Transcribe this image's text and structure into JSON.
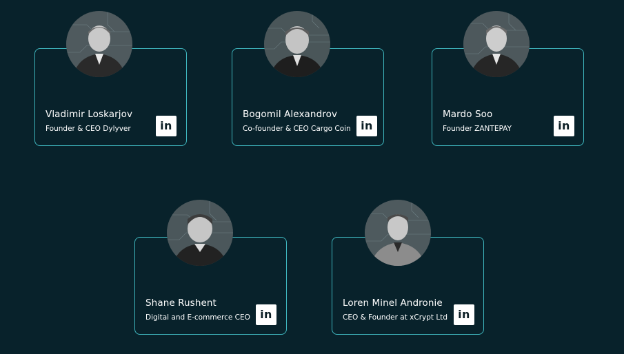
{
  "team": [
    {
      "name": "Vladimir Loskarjov",
      "role": "Founder & CEO Dylyver",
      "linkedin_icon": "linkedin-icon",
      "linkedin_text": "in"
    },
    {
      "name": "Bogomil Alexandrov",
      "role": "Co-founder & CEO Cargo Coin",
      "linkedin_icon": "linkedin-icon",
      "linkedin_text": "in"
    },
    {
      "name": "Mardo Soo",
      "role": "Founder ZANTEPAY",
      "linkedin_icon": "linkedin-icon",
      "linkedin_text": "in"
    },
    {
      "name": "Shane Rushent",
      "role": "Digital and E-commerce CEO",
      "linkedin_icon": "linkedin-icon",
      "linkedin_text": "in"
    },
    {
      "name": "Loren Minel Andronie",
      "role": "CEO & Founder at xCrypt Ltd",
      "linkedin_icon": "linkedin-icon",
      "linkedin_text": "in"
    }
  ],
  "colors": {
    "background": "#08222b",
    "card_border": "#3fb7bf",
    "text": "#ffffff",
    "linkedin_bg": "#ffffff"
  }
}
